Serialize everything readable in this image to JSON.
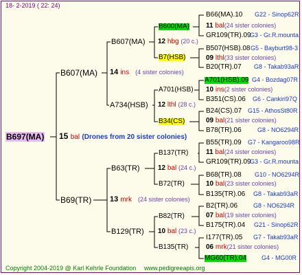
{
  "header": {
    "date": "18-  2-2019 (  22:  24)"
  },
  "footer": {
    "copyright": "Copyright 2004-2019 @ Karl Kehrle Foundation",
    "site": "www.pedigreeapis.org"
  },
  "queen": {
    "name": "B697(MA)",
    "num": "15",
    "sub": "bal",
    "note": "(Drones from 20 sister colonies)"
  },
  "sire_side": {
    "name": "B607(MA)",
    "num": "14",
    "sub": "ins",
    "note": "(4 sister colonies)",
    "p1": {
      "name": "B607(MA)",
      "num": "12",
      "sub": "hbg",
      "note": "(20 c.)",
      "p1": {
        "name": "B600(MA)",
        "num": "11",
        "sub": "bal",
        "note": "(24 sister colonies)",
        "a": "B66(MA).10",
        "aloc": "G22 - Sinop62R",
        "b": "GR109(TR).09",
        "bloc": "G3 - Gr.R.mounta"
      },
      "p2": {
        "name": "B7(HSB)",
        "num": "09",
        "sub": "lthl",
        "note": "(33 sister colonies)",
        "a": "B507(HSB).08",
        "aloc": "G5 - Bayburt98-3",
        "b": "B20(TR).07",
        "bloc": "G8 - Takab93aR"
      }
    },
    "p2": {
      "name": "A734(HSB)",
      "num": "12",
      "sub": "lthl",
      "note": "(28 c.)",
      "p1": {
        "name": "A701(HSB)",
        "num": "10",
        "sub": "ins",
        "note": "(2 sister colonies)",
        "a": "A701(HSB).09",
        "aloc": "G4 - Bozdag07R",
        "b": "B351(CS).06",
        "bloc": "G6 - Cankiri97Q"
      },
      "p2": {
        "name": "B34(CS)",
        "num": "09",
        "sub": "bal",
        "note": "(21 sister colonies)",
        "a": "B24(CS).07",
        "aloc": "G15 - AthosSt80R",
        "b": "B78(TR).06",
        "bloc": "G8 - NO6294R"
      }
    }
  },
  "dam_side": {
    "name": "B69(TR)",
    "num": "13",
    "sub": "mrk",
    "note": "(24 sister colonies)",
    "p1": {
      "name": "B63(TR)",
      "num": "12",
      "sub": "bal",
      "note": "(24 c.)",
      "p1": {
        "name": "B137(TR)",
        "num": "11",
        "sub": "bal",
        "note": "(24 sister colonies)",
        "a": "B55(TR).09",
        "aloc": "G7 - Kangaroo98R",
        "b": "GR109(TR).09",
        "bloc": "G3 - Gr.R.mounta"
      },
      "p2": {
        "name": "B72(TR)",
        "num": "10",
        "sub": "bal",
        "note": "(23 sister colonies)",
        "a": "B68(TR).08",
        "aloc": "G10 - NO6294R",
        "b": "B135(TR).06",
        "bloc": "G8 - Takab93aR"
      }
    },
    "p2": {
      "name": "B129(TR)",
      "num": "10",
      "sub": "bal",
      "note": "(23 c.)",
      "p1": {
        "name": "B82(TR)",
        "num": "07",
        "sub": "bal",
        "note": "(19 sister colonies)",
        "a": "B2(TR).06",
        "aloc": "G8 - NO6294R",
        "b": "B175(TR).04",
        "bloc": "G21 - Sinop62R"
      },
      "p2": {
        "name": "B135(TR)",
        "num": "06",
        "sub": "mrk",
        "note": "(21 sister colonies)",
        "a": "I177(TR).05",
        "aloc": "G7 - Takab93aR",
        "b": "MG60(TR).04",
        "bloc": "G4 - MG00R"
      }
    }
  }
}
